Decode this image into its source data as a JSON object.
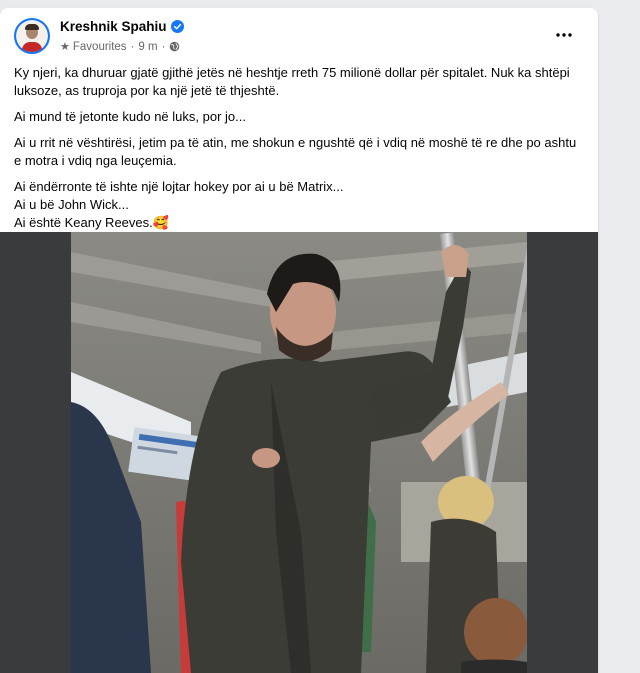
{
  "post": {
    "author": "Kreshnik Spahiu",
    "audience": "Favourites",
    "time": "9 m",
    "more_icon": "more-horizontal-icon",
    "paragraphs": [
      "Ky njeri, ka dhuruar gjatë gjithë jetës në heshtje rreth 75 milionë dollar për spitalet. Nuk ka shtëpi luksoze, as truproja por ka një jetë të thjeshtë.",
      "Ai mund të jetonte kudo në luks, por jo...",
      "Ai u rrit në vështirësi, jetim pa të atin, me shokun e ngushtë që i vdiq në moshë të re dhe po ashtu e motra i vdiq nga leuçemia."
    ],
    "closing_lines": [
      "Ai ëndërronte të ishte një lojtar hokey por ai u bë Matrix...",
      "Ai u bë John Wick...",
      "Ai është Keany Reeves.🥰"
    ]
  },
  "colors": {
    "background": "#e9ebee",
    "card": "#ffffff",
    "verified": "#1877f2",
    "secondary_text": "#65676b"
  }
}
